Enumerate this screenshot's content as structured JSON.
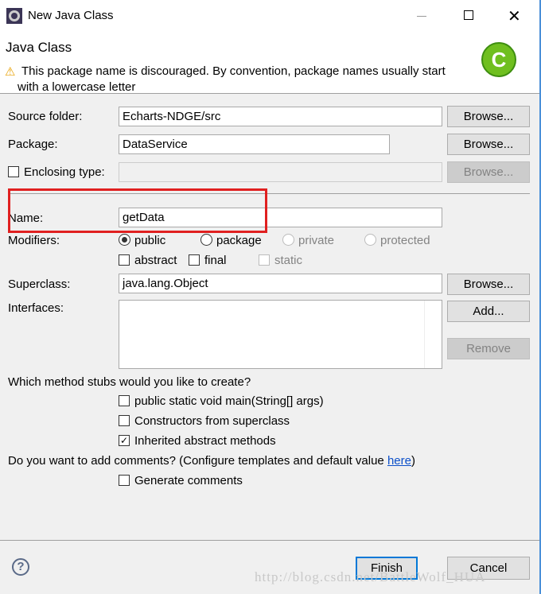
{
  "window": {
    "title": "New Java Class"
  },
  "header": {
    "title": "Java Class",
    "message": "This package name is discouraged. By convention, package names usually start",
    "message2": "with a lowercase letter"
  },
  "form": {
    "source_folder": {
      "label": "Source folder:",
      "value": "Echarts-NDGE/src",
      "button": "Browse..."
    },
    "package": {
      "label": "Package:",
      "value": "DataService",
      "button": "Browse..."
    },
    "enclosing": {
      "label": "Enclosing type:",
      "value": "",
      "button": "Browse...",
      "checked": false
    },
    "name": {
      "label": "Name:",
      "value": "getData"
    },
    "modifiers": {
      "label": "Modifiers:",
      "public": "public",
      "package": "package",
      "private": "private",
      "protected": "protected",
      "abstract": "abstract",
      "final": "final",
      "static": "static",
      "selected": "public"
    },
    "superclass": {
      "label": "Superclass:",
      "value": "java.lang.Object",
      "button": "Browse..."
    },
    "interfaces": {
      "label": "Interfaces:",
      "add": "Add...",
      "remove": "Remove"
    },
    "stubs": {
      "question": "Which method stubs would you like to create?",
      "main": "public static void main(String[] args)",
      "constructors": "Constructors from superclass",
      "inherited": "Inherited abstract methods",
      "inherited_checked": true
    },
    "comments": {
      "question": "Do you want to add comments? (Configure templates and default value ",
      "link": "here",
      "close": ")",
      "generate": "Generate comments"
    }
  },
  "footer": {
    "finish": "Finish",
    "cancel": "Cancel"
  },
  "watermark": "http://blog.csdn.net/BattleWolf_HUA",
  "colors": {
    "highlight": "#e02020",
    "link": "#0b4fc9",
    "focus": "#0078d7"
  }
}
